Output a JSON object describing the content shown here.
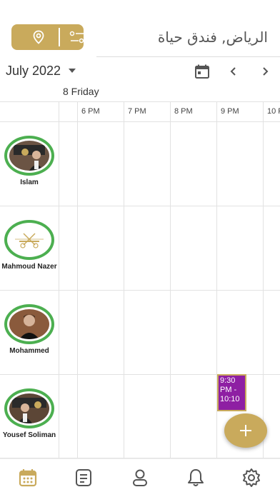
{
  "header": {
    "location_title": "الرياض, فندق حياة",
    "location_icon": "location-pin-icon",
    "filter_icon": "sliders-icon"
  },
  "calendar": {
    "month_label": "July 2022",
    "date_label": "8  Friday",
    "times": [
      "6 PM",
      "7 PM",
      "8 PM",
      "9 PM",
      "10 P"
    ]
  },
  "staff": [
    {
      "name": "Islam",
      "avatar": "photo"
    },
    {
      "name": "Mahmoud Nazer",
      "avatar": "logo"
    },
    {
      "name": "Mohammed",
      "avatar": "photo"
    },
    {
      "name": "Yousef Soliman",
      "avatar": "photo"
    }
  ],
  "events": [
    {
      "text": "9:30 PM - 10:10",
      "color": "#8e1fa3"
    }
  ],
  "colors": {
    "accent": "#c9aa5c",
    "ring": "#4caf50",
    "event": "#8e1fa3"
  },
  "nav": [
    "calendar-icon",
    "list-icon",
    "user-icon",
    "bell-icon",
    "gear-icon"
  ]
}
